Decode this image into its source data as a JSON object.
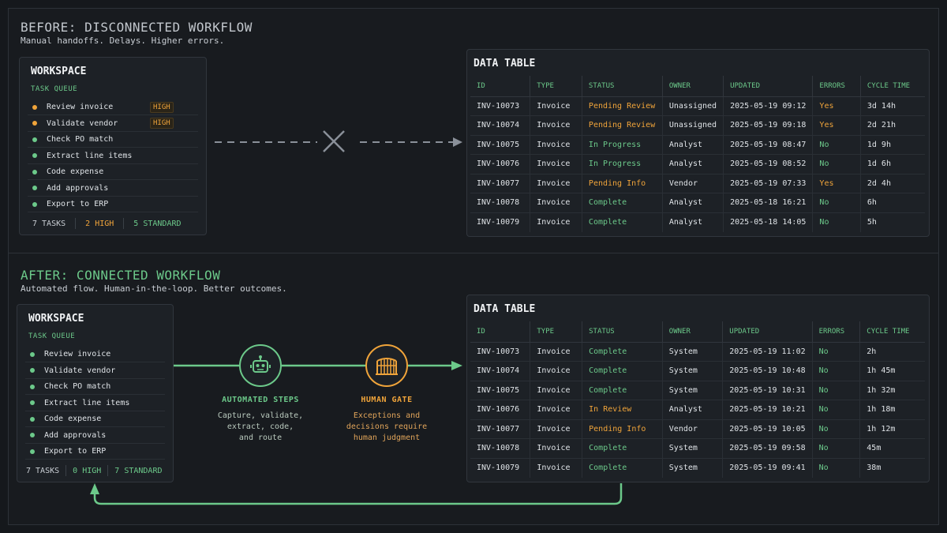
{
  "before": {
    "title": "BEFORE: DISCONNECTED WORKFLOW",
    "subtitle": "Manual handoffs. Delays. Higher errors.",
    "workspace": {
      "title": "WORKSPACE",
      "queue_label": "TASK QUEUE",
      "tasks": [
        {
          "label": "Review invoice",
          "status": "amber",
          "badge": "HIGH"
        },
        {
          "label": "Validate vendor",
          "status": "amber",
          "badge": "HIGH"
        },
        {
          "label": "Check PO match",
          "status": "green",
          "badge": ""
        },
        {
          "label": "Extract line items",
          "status": "green",
          "badge": ""
        },
        {
          "label": "Code expense",
          "status": "green",
          "badge": ""
        },
        {
          "label": "Add approvals",
          "status": "green",
          "badge": ""
        },
        {
          "label": "Export to ERP",
          "status": "green",
          "badge": ""
        }
      ],
      "footer": {
        "total": "7 TASKS",
        "high": "2 HIGH",
        "standard": "5 STANDARD"
      }
    },
    "table": {
      "title": "DATA TABLE",
      "columns": [
        "ID",
        "TYPE",
        "STATUS",
        "OWNER",
        "UPDATED",
        "ERRORS",
        "CYCLE TIME"
      ],
      "rows": [
        [
          "INV-10073",
          "Invoice",
          "Pending Review",
          "Unassigned",
          "2025-05-19 09:12",
          "Yes",
          "3d 14h"
        ],
        [
          "INV-10074",
          "Invoice",
          "Pending Review",
          "Unassigned",
          "2025-05-19 09:18",
          "Yes",
          "2d 21h"
        ],
        [
          "INV-10075",
          "Invoice",
          "In Progress",
          "Analyst",
          "2025-05-19 08:47",
          "No",
          "1d 9h"
        ],
        [
          "INV-10076",
          "Invoice",
          "In Progress",
          "Analyst",
          "2025-05-19 08:52",
          "No",
          "1d 6h"
        ],
        [
          "INV-10077",
          "Invoice",
          "Pending Info",
          "Vendor",
          "2025-05-19 07:33",
          "Yes",
          "2d 4h"
        ],
        [
          "INV-10078",
          "Invoice",
          "Complete",
          "Analyst",
          "2025-05-18 16:21",
          "No",
          "6h"
        ],
        [
          "INV-10079",
          "Invoice",
          "Complete",
          "Analyst",
          "2025-05-18 14:05",
          "No",
          "5h"
        ]
      ]
    }
  },
  "after": {
    "title": "AFTER: CONNECTED WORKFLOW",
    "subtitle": "Automated flow. Human-in-the-loop. Better outcomes.",
    "workspace": {
      "title": "WORKSPACE",
      "queue_label": "TASK QUEUE",
      "tasks": [
        {
          "label": "Review invoice",
          "status": "green",
          "badge": ""
        },
        {
          "label": "Validate vendor",
          "status": "green",
          "badge": ""
        },
        {
          "label": "Check PO match",
          "status": "green",
          "badge": ""
        },
        {
          "label": "Extract line items",
          "status": "green",
          "badge": ""
        },
        {
          "label": "Code expense",
          "status": "green",
          "badge": ""
        },
        {
          "label": "Add approvals",
          "status": "green",
          "badge": ""
        },
        {
          "label": "Export to ERP",
          "status": "green",
          "badge": ""
        }
      ],
      "footer": {
        "total": "7 TASKS",
        "high": "0 HIGH",
        "standard": "7 STANDARD"
      }
    },
    "automated": {
      "title": "AUTOMATED STEPS",
      "desc": "Capture, validate,\nextract, code,\nand route",
      "icon": "robot-icon"
    },
    "gate": {
      "title": "HUMAN GATE",
      "desc": "Exceptions and\ndecisions require\nhuman judgment",
      "icon": "gate-icon"
    },
    "table": {
      "title": "DATA TABLE",
      "columns": [
        "ID",
        "TYPE",
        "STATUS",
        "OWNER",
        "UPDATED",
        "ERRORS",
        "CYCLE TIME"
      ],
      "rows": [
        [
          "INV-10073",
          "Invoice",
          "Complete",
          "System",
          "2025-05-19 11:02",
          "No",
          "2h"
        ],
        [
          "INV-10074",
          "Invoice",
          "Complete",
          "System",
          "2025-05-19 10:48",
          "No",
          "1h 45m"
        ],
        [
          "INV-10075",
          "Invoice",
          "Complete",
          "System",
          "2025-05-19 10:31",
          "No",
          "1h 32m"
        ],
        [
          "INV-10076",
          "Invoice",
          "In Review",
          "Analyst",
          "2025-05-19 10:21",
          "No",
          "1h 18m"
        ],
        [
          "INV-10077",
          "Invoice",
          "Pending Info",
          "Vendor",
          "2025-05-19 10:05",
          "No",
          "1h 12m"
        ],
        [
          "INV-10078",
          "Invoice",
          "Complete",
          "System",
          "2025-05-19 09:58",
          "No",
          "45m"
        ],
        [
          "INV-10079",
          "Invoice",
          "Complete",
          "System",
          "2025-05-19 09:41",
          "No",
          "38m"
        ]
      ]
    }
  },
  "colors": {
    "green": "#6cc98a",
    "amber": "#f0a43a",
    "gray": "#8a9099"
  }
}
